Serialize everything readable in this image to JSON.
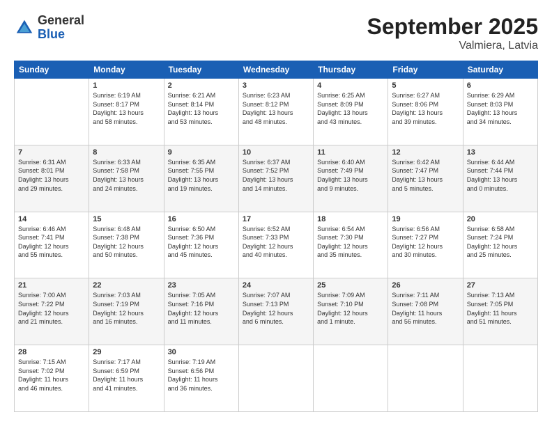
{
  "header": {
    "logo": {
      "general": "General",
      "blue": "Blue"
    },
    "title": "September 2025",
    "location": "Valmiera, Latvia"
  },
  "days_of_week": [
    "Sunday",
    "Monday",
    "Tuesday",
    "Wednesday",
    "Thursday",
    "Friday",
    "Saturday"
  ],
  "weeks": [
    [
      {
        "day": "",
        "info": ""
      },
      {
        "day": "1",
        "info": "Sunrise: 6:19 AM\nSunset: 8:17 PM\nDaylight: 13 hours\nand 58 minutes."
      },
      {
        "day": "2",
        "info": "Sunrise: 6:21 AM\nSunset: 8:14 PM\nDaylight: 13 hours\nand 53 minutes."
      },
      {
        "day": "3",
        "info": "Sunrise: 6:23 AM\nSunset: 8:12 PM\nDaylight: 13 hours\nand 48 minutes."
      },
      {
        "day": "4",
        "info": "Sunrise: 6:25 AM\nSunset: 8:09 PM\nDaylight: 13 hours\nand 43 minutes."
      },
      {
        "day": "5",
        "info": "Sunrise: 6:27 AM\nSunset: 8:06 PM\nDaylight: 13 hours\nand 39 minutes."
      },
      {
        "day": "6",
        "info": "Sunrise: 6:29 AM\nSunset: 8:03 PM\nDaylight: 13 hours\nand 34 minutes."
      }
    ],
    [
      {
        "day": "7",
        "info": "Sunrise: 6:31 AM\nSunset: 8:01 PM\nDaylight: 13 hours\nand 29 minutes."
      },
      {
        "day": "8",
        "info": "Sunrise: 6:33 AM\nSunset: 7:58 PM\nDaylight: 13 hours\nand 24 minutes."
      },
      {
        "day": "9",
        "info": "Sunrise: 6:35 AM\nSunset: 7:55 PM\nDaylight: 13 hours\nand 19 minutes."
      },
      {
        "day": "10",
        "info": "Sunrise: 6:37 AM\nSunset: 7:52 PM\nDaylight: 13 hours\nand 14 minutes."
      },
      {
        "day": "11",
        "info": "Sunrise: 6:40 AM\nSunset: 7:49 PM\nDaylight: 13 hours\nand 9 minutes."
      },
      {
        "day": "12",
        "info": "Sunrise: 6:42 AM\nSunset: 7:47 PM\nDaylight: 13 hours\nand 5 minutes."
      },
      {
        "day": "13",
        "info": "Sunrise: 6:44 AM\nSunset: 7:44 PM\nDaylight: 13 hours\nand 0 minutes."
      }
    ],
    [
      {
        "day": "14",
        "info": "Sunrise: 6:46 AM\nSunset: 7:41 PM\nDaylight: 12 hours\nand 55 minutes."
      },
      {
        "day": "15",
        "info": "Sunrise: 6:48 AM\nSunset: 7:38 PM\nDaylight: 12 hours\nand 50 minutes."
      },
      {
        "day": "16",
        "info": "Sunrise: 6:50 AM\nSunset: 7:36 PM\nDaylight: 12 hours\nand 45 minutes."
      },
      {
        "day": "17",
        "info": "Sunrise: 6:52 AM\nSunset: 7:33 PM\nDaylight: 12 hours\nand 40 minutes."
      },
      {
        "day": "18",
        "info": "Sunrise: 6:54 AM\nSunset: 7:30 PM\nDaylight: 12 hours\nand 35 minutes."
      },
      {
        "day": "19",
        "info": "Sunrise: 6:56 AM\nSunset: 7:27 PM\nDaylight: 12 hours\nand 30 minutes."
      },
      {
        "day": "20",
        "info": "Sunrise: 6:58 AM\nSunset: 7:24 PM\nDaylight: 12 hours\nand 25 minutes."
      }
    ],
    [
      {
        "day": "21",
        "info": "Sunrise: 7:00 AM\nSunset: 7:22 PM\nDaylight: 12 hours\nand 21 minutes."
      },
      {
        "day": "22",
        "info": "Sunrise: 7:03 AM\nSunset: 7:19 PM\nDaylight: 12 hours\nand 16 minutes."
      },
      {
        "day": "23",
        "info": "Sunrise: 7:05 AM\nSunset: 7:16 PM\nDaylight: 12 hours\nand 11 minutes."
      },
      {
        "day": "24",
        "info": "Sunrise: 7:07 AM\nSunset: 7:13 PM\nDaylight: 12 hours\nand 6 minutes."
      },
      {
        "day": "25",
        "info": "Sunrise: 7:09 AM\nSunset: 7:10 PM\nDaylight: 12 hours\nand 1 minute."
      },
      {
        "day": "26",
        "info": "Sunrise: 7:11 AM\nSunset: 7:08 PM\nDaylight: 11 hours\nand 56 minutes."
      },
      {
        "day": "27",
        "info": "Sunrise: 7:13 AM\nSunset: 7:05 PM\nDaylight: 11 hours\nand 51 minutes."
      }
    ],
    [
      {
        "day": "28",
        "info": "Sunrise: 7:15 AM\nSunset: 7:02 PM\nDaylight: 11 hours\nand 46 minutes."
      },
      {
        "day": "29",
        "info": "Sunrise: 7:17 AM\nSunset: 6:59 PM\nDaylight: 11 hours\nand 41 minutes."
      },
      {
        "day": "30",
        "info": "Sunrise: 7:19 AM\nSunset: 6:56 PM\nDaylight: 11 hours\nand 36 minutes."
      },
      {
        "day": "",
        "info": ""
      },
      {
        "day": "",
        "info": ""
      },
      {
        "day": "",
        "info": ""
      },
      {
        "day": "",
        "info": ""
      }
    ]
  ]
}
